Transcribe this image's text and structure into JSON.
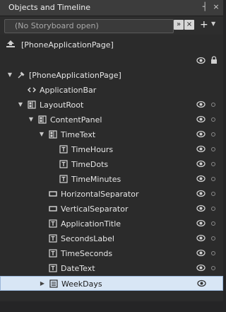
{
  "panel": {
    "title": "Objects and Timeline",
    "pin_glyph": "┤",
    "close_glyph": "×"
  },
  "storyboard": {
    "placeholder": "(No Storyboard open)",
    "expand_glyph": "»",
    "close_glyph": "×",
    "add_glyph": "+",
    "dropdown_glyph": "▼"
  },
  "scope": {
    "label": "[PhoneApplicationPage]"
  },
  "tree": [
    {
      "label": "[PhoneApplicationPage]",
      "icon": "pin-icon",
      "level": 0,
      "expander": "expanded",
      "eye": false,
      "dot": false,
      "selected": false
    },
    {
      "label": "ApplicationBar",
      "icon": "code-brackets-icon",
      "level": 1,
      "expander": "none",
      "eye": false,
      "dot": false,
      "selected": false
    },
    {
      "label": "LayoutRoot",
      "icon": "grid-icon",
      "level": 1,
      "expander": "expanded",
      "eye": true,
      "dot": true,
      "selected": false
    },
    {
      "label": "ContentPanel",
      "icon": "grid-icon",
      "level": 2,
      "expander": "expanded",
      "eye": true,
      "dot": true,
      "selected": false
    },
    {
      "label": "TimeText",
      "icon": "grid-icon",
      "level": 3,
      "expander": "expanded",
      "eye": true,
      "dot": true,
      "selected": false
    },
    {
      "label": "TimeHours",
      "icon": "textblock-icon",
      "level": 4,
      "expander": "none",
      "eye": true,
      "dot": true,
      "selected": false
    },
    {
      "label": "TimeDots",
      "icon": "textblock-icon",
      "level": 4,
      "expander": "none",
      "eye": true,
      "dot": true,
      "selected": false
    },
    {
      "label": "TimeMinutes",
      "icon": "textblock-icon",
      "level": 4,
      "expander": "none",
      "eye": true,
      "dot": true,
      "selected": false
    },
    {
      "label": "HorizontalSeparator",
      "icon": "rectangle-icon",
      "level": 3,
      "expander": "none",
      "eye": true,
      "dot": true,
      "selected": false
    },
    {
      "label": "VerticalSeparator",
      "icon": "rectangle-icon",
      "level": 3,
      "expander": "none",
      "eye": true,
      "dot": true,
      "selected": false
    },
    {
      "label": "ApplicationTitle",
      "icon": "textblock-icon",
      "level": 3,
      "expander": "none",
      "eye": true,
      "dot": true,
      "selected": false
    },
    {
      "label": "SecondsLabel",
      "icon": "textblock-icon",
      "level": 3,
      "expander": "none",
      "eye": true,
      "dot": true,
      "selected": false
    },
    {
      "label": "TimeSeconds",
      "icon": "textblock-icon",
      "level": 3,
      "expander": "none",
      "eye": true,
      "dot": true,
      "selected": false
    },
    {
      "label": "DateText",
      "icon": "textblock-icon",
      "level": 3,
      "expander": "none",
      "eye": true,
      "dot": true,
      "selected": false
    },
    {
      "label": "WeekDays",
      "icon": "listbox-icon",
      "level": 3,
      "expander": "collapsed",
      "eye": true,
      "dot": false,
      "selected": true
    }
  ],
  "colors": {
    "panel_bg": "#2b2b2b",
    "selection_bg": "#d8e6f5",
    "selection_border": "#9ab6d9"
  }
}
